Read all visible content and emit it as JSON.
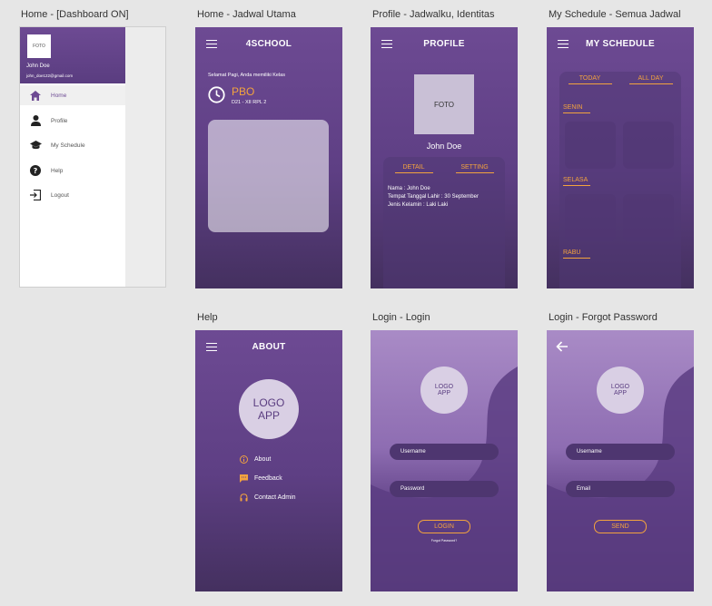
{
  "titles": {
    "t1": "Home - [Dashboard ON]",
    "t2": "Home - Jadwal Utama",
    "t3": "Profile - Jadwalku, Identitas",
    "t4": "My Schedule  - Semua Jadwal",
    "t5": "Help",
    "t6": "Login - Login",
    "t7": "Login - Forgot Password"
  },
  "drawer": {
    "foto": "FOTO",
    "name": "John Doe",
    "email": "john_doe122@gmail.com",
    "items": [
      {
        "label": "Home",
        "icon": "home-icon"
      },
      {
        "label": "Profile",
        "icon": "person-icon"
      },
      {
        "label": "My Schedule",
        "icon": "school-icon"
      },
      {
        "label": "Help",
        "icon": "help-icon"
      },
      {
        "label": "Logout",
        "icon": "logout-icon"
      }
    ]
  },
  "home": {
    "title": "4SCHOOL",
    "greeting": "Selamat Pagi, Anda memiliki Kelas",
    "subject": "PBO",
    "room": "D21 - XII RPL 2"
  },
  "profile": {
    "title": "PROFILE",
    "foto": "FOTO",
    "name": "John Doe",
    "tab_detail": "DETAIL",
    "tab_setting": "SETTING",
    "nama": "Nama : John Doe",
    "ttl": "Tempat Tanggal Lahir : 30 September",
    "jk": "Jenis Kelamin : Laki Laki"
  },
  "schedule": {
    "title": "MY SCHEDULE",
    "tab_today": "TODAY",
    "tab_all": "ALL DAY",
    "days": [
      "SENIN",
      "SELASA",
      "RABU"
    ]
  },
  "about": {
    "title": "ABOUT",
    "logo": "LOGO\nAPP",
    "logo_l1": "LOGO",
    "logo_l2": "APP",
    "items": [
      "About",
      "Feedback",
      "Contact Admin"
    ]
  },
  "login": {
    "logo_l1": "LOGO",
    "logo_l2": "APP",
    "username": "Username",
    "password": "Password",
    "button": "LOGIN",
    "forgot": "Forgot Password?"
  },
  "forgot": {
    "logo_l1": "LOGO",
    "logo_l2": "APP",
    "username": "Username",
    "email": "Email",
    "button": "SEND"
  },
  "colors": {
    "primary": "#6d4a93",
    "accent": "#f3a33e"
  }
}
